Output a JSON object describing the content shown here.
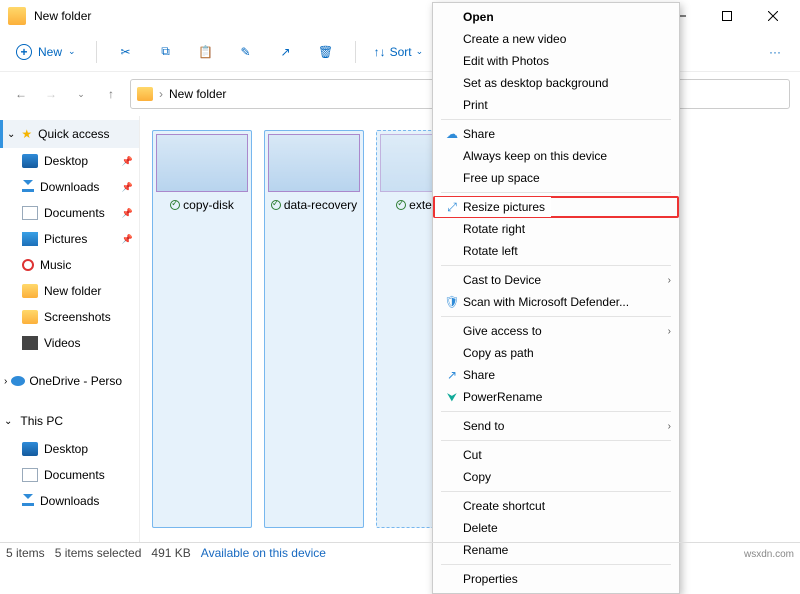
{
  "title": "New folder",
  "toolbar": {
    "new": "New",
    "sort": "Sort",
    "more": "···"
  },
  "breadcrumb": "New folder",
  "sidebar": {
    "quick_access": "Quick access",
    "items": [
      {
        "label": "Desktop"
      },
      {
        "label": "Downloads"
      },
      {
        "label": "Documents"
      },
      {
        "label": "Pictures"
      },
      {
        "label": "Music"
      },
      {
        "label": "New folder"
      },
      {
        "label": "Screenshots"
      },
      {
        "label": "Videos"
      }
    ],
    "onedrive": "OneDrive - Perso",
    "thispc": "This PC",
    "pc_items": [
      {
        "label": "Desktop"
      },
      {
        "label": "Documents"
      },
      {
        "label": "Downloads"
      }
    ]
  },
  "files": [
    {
      "name": "copy-disk"
    },
    {
      "name": "data-recovery"
    },
    {
      "name": "extend-n"
    }
  ],
  "context_menu": {
    "open": "Open",
    "create_video": "Create a new video",
    "edit_photos": "Edit with Photos",
    "set_bg": "Set as desktop background",
    "print": "Print",
    "share": "Share",
    "always_keep": "Always keep on this device",
    "free_up": "Free up space",
    "resize": "Resize pictures",
    "rotate_right": "Rotate right",
    "rotate_left": "Rotate left",
    "cast": "Cast to Device",
    "scan": "Scan with Microsoft Defender...",
    "give_access": "Give access to",
    "copy_path": "Copy as path",
    "share2": "Share",
    "powerrename": "PowerRename",
    "send_to": "Send to",
    "cut": "Cut",
    "copy": "Copy",
    "shortcut": "Create shortcut",
    "delete": "Delete",
    "rename": "Rename",
    "properties": "Properties"
  },
  "status": {
    "count": "5 items",
    "selected": "5 items selected",
    "size": "491 KB",
    "available": "Available on this device"
  },
  "watermark": "wsxdn.com"
}
